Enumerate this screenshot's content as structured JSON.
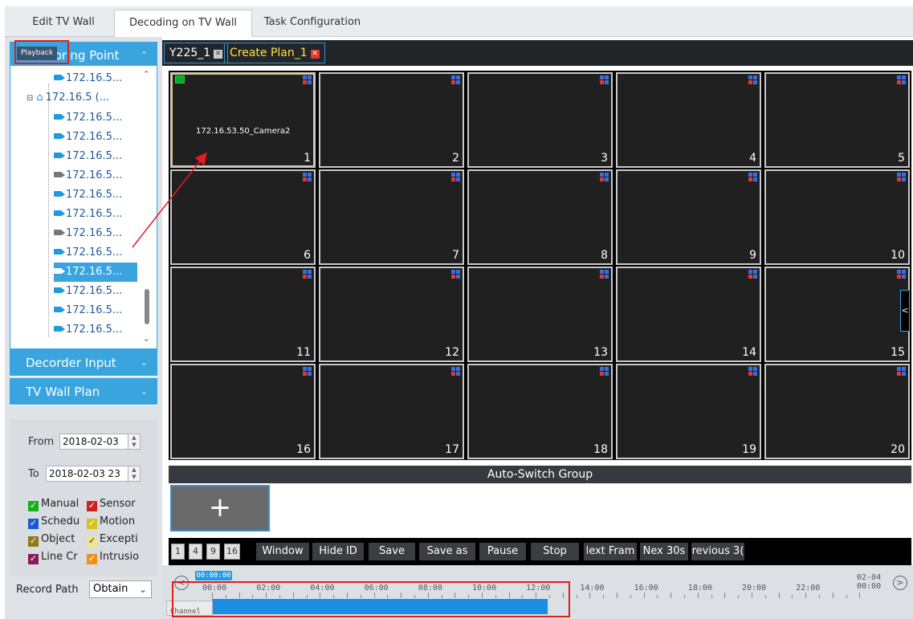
{
  "top_tabs": [
    {
      "label": "Edit TV Wall"
    },
    {
      "label": "Decoding on TV Wall"
    },
    {
      "label": "Task Configuration"
    }
  ],
  "playback_tooltip": "Playback",
  "sidebar": {
    "monitoring_point_header": "toring Point",
    "tree": [
      {
        "label": "172.16.5..."
      },
      {
        "label": "172.16.5 (..."
      },
      {
        "label": "172.16.5..."
      },
      {
        "label": "172.16.5..."
      },
      {
        "label": "172.16.5..."
      },
      {
        "label": "172.16.5..."
      },
      {
        "label": "172.16.5..."
      },
      {
        "label": "172.16.5..."
      },
      {
        "label": "172.16.5..."
      },
      {
        "label": "172.16.5..."
      },
      {
        "label": "172.16.5..."
      },
      {
        "label": "172.16.5..."
      },
      {
        "label": "172.16.5..."
      },
      {
        "label": "172.16.5..."
      }
    ],
    "decoder_input_header": "Decorder Input",
    "tv_wall_plan_header": "TV Wall Plan"
  },
  "filter": {
    "from_label": "From",
    "from_value": "2018-02-03",
    "to_label": "To",
    "to_value": "2018-02-03 23",
    "checkboxes": [
      {
        "label": "Manual",
        "color": "#16b016"
      },
      {
        "label": "Sensor",
        "color": "#d41f1f"
      },
      {
        "label": "Schedu",
        "color": "#1a5bd4"
      },
      {
        "label": "Motion",
        "color": "#d6c21a"
      },
      {
        "label": "Object",
        "color": "#8f7a1a"
      },
      {
        "label": "Excepti",
        "color": "#f1e58a"
      },
      {
        "label": "Line Cr",
        "color": "#8a1c5e"
      },
      {
        "label": "Intrusio",
        "color": "#f09016"
      }
    ],
    "record_path_label": "Record Path",
    "record_path_value": "Obtain"
  },
  "plan_tabs": [
    {
      "label": "Y225_1"
    },
    {
      "label": "Create Plan_1"
    }
  ],
  "screens": [
    {
      "number": "1",
      "camera": "172.16.53.50_Camera2"
    },
    {
      "number": "2"
    },
    {
      "number": "3"
    },
    {
      "number": "4"
    },
    {
      "number": "5"
    },
    {
      "number": "6"
    },
    {
      "number": "7"
    },
    {
      "number": "8"
    },
    {
      "number": "9"
    },
    {
      "number": "10"
    },
    {
      "number": "11"
    },
    {
      "number": "12"
    },
    {
      "number": "13"
    },
    {
      "number": "14"
    },
    {
      "number": "15"
    },
    {
      "number": "16"
    },
    {
      "number": "17"
    },
    {
      "number": "18"
    },
    {
      "number": "19"
    },
    {
      "number": "20"
    }
  ],
  "auto_switch_group": {
    "title": "Auto-Switch Group",
    "add_symbol": "+"
  },
  "controls": {
    "split_buttons": [
      "1",
      "4",
      "9",
      "16"
    ],
    "buttons": [
      "Window",
      "Hide ID",
      "Save",
      "Save as",
      "Pause",
      "Stop",
      "lext Fram",
      "Nex 30s",
      "revious 3("
    ]
  },
  "timeline": {
    "current_time": "00:00:00",
    "labels": [
      "00:00",
      "02:00",
      "04:00",
      "06:00",
      "08:00",
      "10:00",
      "12:00",
      "14:00",
      "16:00",
      "18:00",
      "20:00",
      "22:00"
    ],
    "end_date": "02-04",
    "end_time": "00:00",
    "channel_label": "Channel",
    "prev_icon": "<",
    "next_icon": ">"
  }
}
